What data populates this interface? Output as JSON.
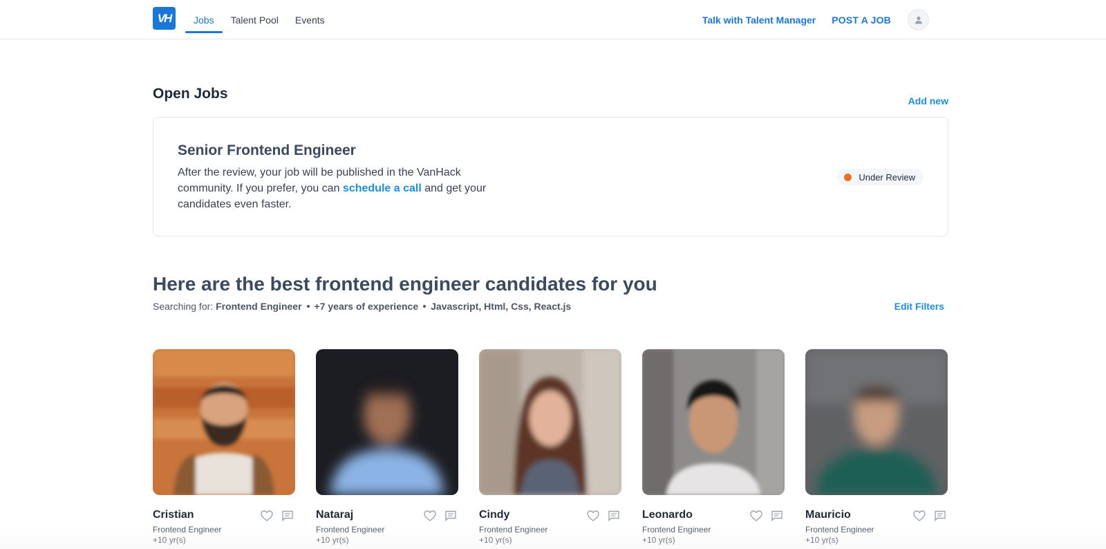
{
  "header": {
    "logo_text": "VH",
    "nav": [
      {
        "label": "Jobs",
        "active": true
      },
      {
        "label": "Talent Pool",
        "active": false
      },
      {
        "label": "Events",
        "active": false
      }
    ],
    "talk_label": "Talk with Talent Manager",
    "post_label": "POST A JOB",
    "avatar_icon": "user-icon"
  },
  "open_jobs": {
    "title": "Open Jobs",
    "add_new": "Add new",
    "job": {
      "title": "Senior Frontend Engineer",
      "desc_before": "After the review, your job will be published in the VanHack community. If you prefer, you can ",
      "desc_link": "schedule a call",
      "desc_after": " and get your candidates even faster.",
      "status": "Under Review",
      "status_color": "#f36b1c"
    }
  },
  "candidates": {
    "heading": "Here are the best frontend engineer candidates for you",
    "searching_label": "Searching for:",
    "criteria": [
      "Frontend Engineer",
      "+7 years of experience",
      "Javascript, Html, Css, React.js"
    ],
    "edit_filters": "Edit Filters",
    "list": [
      {
        "name": "Cristian",
        "role": "Frontend Engineer",
        "experience": "+10 yr(s)"
      },
      {
        "name": "Nataraj",
        "role": "Frontend Engineer",
        "experience": "+10 yr(s)"
      },
      {
        "name": "Cindy",
        "role": "Frontend Engineer",
        "experience": "+10 yr(s)"
      },
      {
        "name": "Leonardo",
        "role": "Frontend Engineer",
        "experience": "+10 yr(s)"
      },
      {
        "name": "Mauricio",
        "role": "Frontend Engineer",
        "experience": "+10 yr(s)"
      }
    ]
  },
  "colors": {
    "brand": "#1877d8",
    "link": "#1a8fe0",
    "heading": "#3b4a5e"
  }
}
